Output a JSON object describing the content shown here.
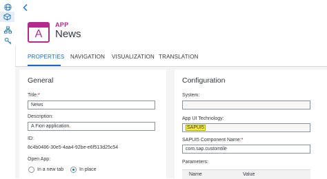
{
  "app": {
    "type_label": "APP",
    "title": "News",
    "icon_letter": "A",
    "accent_color": "#b5288d"
  },
  "side_rail": {
    "icons": [
      "globe-icon",
      "cube-icon",
      "hierarchy-icon",
      "key-icon"
    ]
  },
  "tabs": [
    {
      "label": "PROPERTIES",
      "active": true
    },
    {
      "label": "NAVIGATION",
      "active": false
    },
    {
      "label": "VISUALIZATION",
      "active": false
    },
    {
      "label": "TRANSLATION",
      "active": false
    }
  ],
  "general": {
    "section_title": "General",
    "title_label": "Title:",
    "required_mark": "*",
    "title_value": "News",
    "description_label": "Description:",
    "description_value": "A Fiori application.",
    "id_label": "ID:",
    "id_value": "8c4b0486-30e5-4aa4-92be-e6f513d25c54",
    "open_app_label": "Open App:",
    "open_app_options": [
      "In a new tab",
      "In place"
    ],
    "open_app_selected": "In place"
  },
  "configuration": {
    "section_title": "Configuration",
    "system_label": "System:",
    "system_value": "",
    "ui_tech_label": "App UI Technology:",
    "ui_tech_value": "SAPUI5",
    "component_label": "SAPUI5 Component Name:",
    "required_mark": "*",
    "component_value": "com.sap.customtile",
    "parameters_label": "Parameters:",
    "param_columns": [
      "Name",
      "Value"
    ]
  },
  "colors": {
    "link_blue": "#0a6ed1",
    "highlight": "#ffeb3b"
  }
}
